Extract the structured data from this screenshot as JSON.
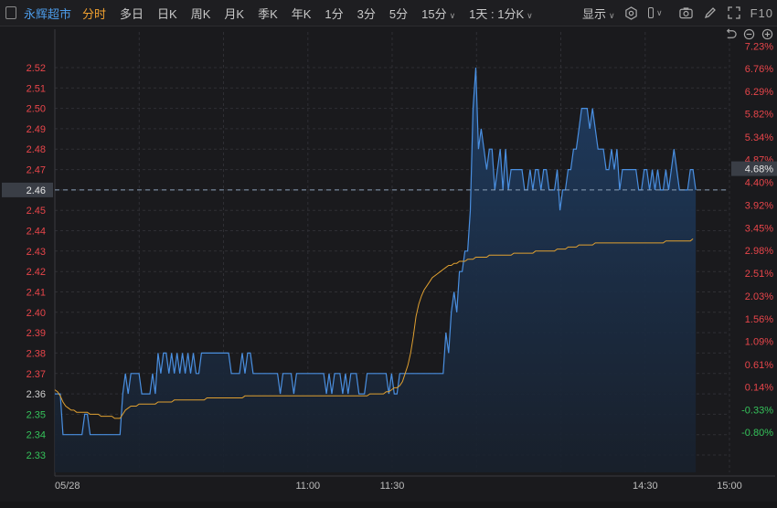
{
  "toolbar": {
    "stock_name": "永辉超市",
    "periods": [
      "分时",
      "多日",
      "日K",
      "周K",
      "月K",
      "季K",
      "年K",
      "1分",
      "3分",
      "5分",
      "15分"
    ],
    "active_period": "分时",
    "adjust_label": "1天 : 1分K",
    "display_label": "显示",
    "f10_label": "F10"
  },
  "icons": {
    "toolbar_right": [
      "settings-icon",
      "checkbox-icon",
      "camera-icon",
      "pencil-icon",
      "fullscreen-icon"
    ],
    "sub_tools": [
      "undo-icon",
      "zoom-out-icon",
      "zoom-in-icon"
    ]
  },
  "colors": {
    "price_line": "#4a8fe0",
    "avg_line": "#e0a030",
    "fill_top": "#1e3a5c",
    "fill_bottom": "#1a2230",
    "up": "#e8454a",
    "down": "#35c25a",
    "neutral": "#cfcfcf",
    "prev_close_line": "#8aa0b8"
  },
  "chart_data": {
    "type": "line",
    "prev_close": 2.36,
    "current_price_label": "2.46",
    "current_pct_label": "4.68%",
    "ylim": [
      2.33,
      2.52
    ],
    "y_ticks": [
      "2.52",
      "2.51",
      "2.50",
      "2.49",
      "2.48",
      "2.47",
      "2.46",
      "2.45",
      "2.44",
      "2.43",
      "2.42",
      "2.41",
      "2.40",
      "2.39",
      "2.38",
      "2.37",
      "2.36",
      "2.35",
      "2.34",
      "2.33"
    ],
    "pct_ticks": [
      "7.23%",
      "6.76%",
      "6.29%",
      "5.82%",
      "5.34%",
      "4.87%",
      "4.68%",
      "4.40%",
      "3.92%",
      "3.45%",
      "2.98%",
      "2.51%",
      "2.03%",
      "1.56%",
      "1.09%",
      "0.61%",
      "0.14%",
      "-0.33%",
      "-0.80%"
    ],
    "pct_values": [
      7.23,
      6.76,
      6.29,
      5.82,
      5.34,
      4.87,
      4.68,
      4.4,
      3.92,
      3.45,
      2.98,
      2.51,
      2.03,
      1.56,
      1.09,
      0.61,
      0.14,
      -0.33,
      -0.8
    ],
    "x_labels": [
      "05/28",
      "11:00",
      "11:30",
      "14:30",
      "15:00"
    ],
    "x_label_minutes": [
      0,
      90,
      120,
      210,
      240
    ],
    "total_minutes": 240,
    "series": [
      {
        "kind": "price",
        "values": [
          2.36,
          2.36,
          2.36,
          2.34,
          2.34,
          2.34,
          2.34,
          2.34,
          2.34,
          2.34,
          2.34,
          2.35,
          2.35,
          2.34,
          2.34,
          2.34,
          2.34,
          2.34,
          2.34,
          2.34,
          2.34,
          2.34,
          2.34,
          2.34,
          2.34,
          2.36,
          2.37,
          2.36,
          2.37,
          2.37,
          2.37,
          2.37,
          2.36,
          2.36,
          2.36,
          2.36,
          2.37,
          2.36,
          2.38,
          2.37,
          2.38,
          2.38,
          2.37,
          2.38,
          2.37,
          2.38,
          2.37,
          2.38,
          2.37,
          2.38,
          2.37,
          2.38,
          2.37,
          2.37,
          2.38,
          2.38,
          2.38,
          2.38,
          2.38,
          2.38,
          2.38,
          2.38,
          2.38,
          2.38,
          2.38,
          2.37,
          2.37,
          2.37,
          2.37,
          2.38,
          2.37,
          2.38,
          2.38,
          2.37,
          2.37,
          2.37,
          2.37,
          2.37,
          2.37,
          2.37,
          2.37,
          2.37,
          2.37,
          2.36,
          2.37,
          2.37,
          2.37,
          2.37,
          2.36,
          2.37,
          2.37,
          2.37,
          2.37,
          2.37,
          2.37,
          2.37,
          2.37,
          2.37,
          2.37,
          2.37,
          2.36,
          2.37,
          2.36,
          2.37,
          2.37,
          2.37,
          2.36,
          2.37,
          2.36,
          2.37,
          2.37,
          2.37,
          2.36,
          2.36,
          2.36,
          2.37,
          2.37,
          2.37,
          2.37,
          2.37,
          2.37,
          2.37,
          2.37,
          2.36,
          2.37,
          2.36,
          2.36,
          2.37,
          2.37,
          2.37,
          2.37,
          2.37,
          2.37,
          2.37,
          2.37,
          2.37,
          2.37,
          2.37,
          2.37,
          2.37,
          2.37,
          2.37,
          2.37,
          2.37,
          2.39,
          2.38,
          2.4,
          2.41,
          2.4,
          2.42,
          2.42,
          2.43,
          2.43,
          2.45,
          2.5,
          2.52,
          2.48,
          2.49,
          2.48,
          2.47,
          2.48,
          2.48,
          2.46,
          2.47,
          2.48,
          2.46,
          2.48,
          2.46,
          2.47,
          2.47,
          2.47,
          2.47,
          2.47,
          2.46,
          2.46,
          2.47,
          2.46,
          2.47,
          2.47,
          2.46,
          2.47,
          2.47,
          2.46,
          2.46,
          2.46,
          2.47,
          2.45,
          2.46,
          2.46,
          2.47,
          2.47,
          2.48,
          2.48,
          2.49,
          2.5,
          2.5,
          2.5,
          2.49,
          2.5,
          2.49,
          2.48,
          2.48,
          2.48,
          2.47,
          2.47,
          2.48,
          2.47,
          2.48,
          2.46,
          2.47,
          2.47,
          2.47,
          2.47,
          2.47,
          2.47,
          2.46,
          2.46,
          2.47,
          2.47,
          2.46,
          2.47,
          2.46,
          2.47,
          2.46,
          2.46,
          2.47,
          2.46,
          2.47,
          2.48,
          2.47,
          2.46,
          2.46,
          2.46,
          2.46,
          2.47,
          2.47,
          2.46
        ]
      },
      {
        "kind": "average",
        "values": [
          2.362,
          2.361,
          2.359,
          2.356,
          2.354,
          2.353,
          2.352,
          2.352,
          2.351,
          2.351,
          2.351,
          2.351,
          2.351,
          2.35,
          2.35,
          2.35,
          2.35,
          2.349,
          2.349,
          2.349,
          2.349,
          2.349,
          2.348,
          2.348,
          2.348,
          2.35,
          2.352,
          2.353,
          2.354,
          2.354,
          2.354,
          2.355,
          2.355,
          2.355,
          2.355,
          2.355,
          2.355,
          2.355,
          2.356,
          2.356,
          2.356,
          2.356,
          2.356,
          2.356,
          2.357,
          2.357,
          2.357,
          2.357,
          2.357,
          2.357,
          2.357,
          2.357,
          2.357,
          2.357,
          2.357,
          2.357,
          2.358,
          2.358,
          2.358,
          2.358,
          2.358,
          2.358,
          2.358,
          2.358,
          2.358,
          2.358,
          2.358,
          2.358,
          2.358,
          2.358,
          2.359,
          2.359,
          2.359,
          2.359,
          2.359,
          2.359,
          2.359,
          2.359,
          2.359,
          2.359,
          2.359,
          2.359,
          2.359,
          2.359,
          2.359,
          2.359,
          2.359,
          2.359,
          2.359,
          2.359,
          2.359,
          2.359,
          2.359,
          2.359,
          2.359,
          2.359,
          2.359,
          2.359,
          2.359,
          2.359,
          2.359,
          2.359,
          2.359,
          2.359,
          2.359,
          2.359,
          2.359,
          2.359,
          2.359,
          2.359,
          2.359,
          2.359,
          2.359,
          2.359,
          2.359,
          2.359,
          2.36,
          2.36,
          2.36,
          2.36,
          2.36,
          2.36,
          2.361,
          2.361,
          2.362,
          2.363,
          2.363,
          2.364,
          2.366,
          2.37,
          2.374,
          2.38,
          2.388,
          2.398,
          2.404,
          2.408,
          2.411,
          2.413,
          2.415,
          2.417,
          2.418,
          2.419,
          2.42,
          2.421,
          2.422,
          2.423,
          2.423,
          2.424,
          2.424,
          2.425,
          2.425,
          2.425,
          2.426,
          2.426,
          2.426,
          2.427,
          2.427,
          2.427,
          2.427,
          2.427,
          2.428,
          2.428,
          2.428,
          2.428,
          2.428,
          2.428,
          2.428,
          2.428,
          2.428,
          2.429,
          2.429,
          2.429,
          2.429,
          2.429,
          2.429,
          2.429,
          2.429,
          2.43,
          2.43,
          2.43,
          2.43,
          2.43,
          2.43,
          2.43,
          2.43,
          2.431,
          2.431,
          2.431,
          2.431,
          2.432,
          2.432,
          2.432,
          2.432,
          2.433,
          2.433,
          2.433,
          2.433,
          2.433,
          2.433,
          2.434,
          2.434,
          2.434,
          2.434,
          2.434,
          2.434,
          2.434,
          2.434,
          2.434,
          2.434,
          2.434,
          2.434,
          2.434,
          2.434,
          2.434,
          2.434,
          2.434,
          2.434,
          2.434,
          2.434,
          2.434,
          2.434,
          2.434,
          2.434,
          2.434,
          2.434,
          2.435,
          2.435,
          2.435,
          2.435,
          2.435,
          2.435,
          2.435,
          2.435,
          2.435,
          2.435,
          2.436
        ]
      }
    ]
  }
}
